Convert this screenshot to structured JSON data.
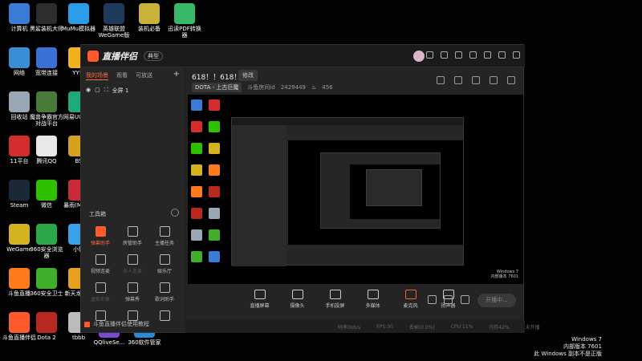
{
  "desktop_icons_col1": [
    {
      "label": "计算机",
      "color": "#3a7bd5"
    },
    {
      "label": "网络",
      "color": "#3a8ed5"
    },
    {
      "label": "回收站",
      "color": "#9aa7b5"
    },
    {
      "label": "11平台",
      "color": "#d42d2d"
    },
    {
      "label": "Steam",
      "color": "#1b2838"
    },
    {
      "label": "WeGame",
      "color": "#d4b21f"
    },
    {
      "label": "斗鱼直播",
      "color": "#ff7a1a"
    },
    {
      "label": "斗鱼直播伴侣",
      "color": "#ff5a2c"
    }
  ],
  "desktop_icons_col2": [
    {
      "label": "黑鲨装机大师",
      "color": "#2d2d2d"
    },
    {
      "label": "宽带连接",
      "color": "#3a6fd5"
    },
    {
      "label": "魔兽争霸官方对战平台",
      "color": "#4a7a3a"
    },
    {
      "label": "腾讯QQ",
      "color": "#e8e8e8"
    },
    {
      "label": "微信",
      "color": "#2dc100"
    },
    {
      "label": "360安全浏览器",
      "color": "#2aa84a"
    },
    {
      "label": "360安全卫士",
      "color": "#3fae2a"
    },
    {
      "label": "Dota 2",
      "color": "#b8281e"
    }
  ],
  "desktop_icons_col3": [
    {
      "label": "MuMu模拟器",
      "color": "#2b9de8"
    },
    {
      "label": "YY语",
      "color": "#f2b01e"
    },
    {
      "label": "网易UU加速",
      "color": "#1fa87a"
    },
    {
      "label": "BS",
      "color": "#d4a21f"
    },
    {
      "label": "暴雨(Mahjo",
      "color": "#c82a3a"
    },
    {
      "label": "小智",
      "color": "#3aa0e8"
    },
    {
      "label": "新天龙之小",
      "color": "#e8a01f"
    },
    {
      "label": "tbbb",
      "color": "#bbbbbb"
    }
  ],
  "desktop_icons_top": [
    {
      "label": "英雄联盟WeGame版",
      "color": "#1e3a5a"
    },
    {
      "label": "装机必备",
      "color": "#c8b23a"
    },
    {
      "label": "迅读PDF转换器",
      "color": "#3ab86a"
    }
  ],
  "desktop_icons_bottom": [
    {
      "label": "QQliveSe...",
      "color": "#7a4ad5"
    },
    {
      "label": "360软件管家",
      "color": "#2a8ad5"
    }
  ],
  "app": {
    "title": "直播伴侣",
    "version_badge": "典型",
    "left_tabs": [
      "我的场景",
      "观看",
      "可放送"
    ],
    "add_label": "+",
    "scene_item": "全屏 1",
    "toolbox_title": "工具箱",
    "tools": [
      {
        "label": "弹幕助手",
        "state": "hot"
      },
      {
        "label": "房管助手",
        "state": "normal"
      },
      {
        "label": "主播任务",
        "state": "normal"
      },
      {
        "label": "视频连麦",
        "state": "normal"
      },
      {
        "label": "多人连麦",
        "state": "dim"
      },
      {
        "label": "娱乐厅",
        "state": "normal"
      },
      {
        "label": "虚拟形象",
        "state": "dim"
      },
      {
        "label": "弹幕秀",
        "state": "normal"
      },
      {
        "label": "歌词助手",
        "state": "normal"
      },
      {
        "label": "",
        "state": "normal"
      },
      {
        "label": "",
        "state": "normal"
      },
      {
        "label": "",
        "state": "normal"
      }
    ],
    "tutorial_label": "斗鱼直播伴侣使用教程",
    "stream_title": "618！！618！！",
    "edit_label": "修改",
    "category": "DOTA - 上古巨魔",
    "room_id_label": "斗鱼房间id",
    "room_id": "2429449",
    "hot_value": "456",
    "controls": [
      {
        "label": "直播屏幕",
        "accent": false
      },
      {
        "label": "摄像头",
        "accent": false
      },
      {
        "label": "手机投屏",
        "accent": false
      },
      {
        "label": "多媒体",
        "accent": false
      },
      {
        "label": "麦克风",
        "accent": true
      },
      {
        "label": "扬声器",
        "accent": false
      }
    ],
    "go_live_label": "开播中...",
    "status": [
      "码率0kb/s",
      "FPS:30",
      "丢帧(0.0%)",
      "CPU:11%",
      "内存42%",
      "未开播"
    ]
  },
  "watermark": {
    "line1": "Windows 7",
    "line2": "内部版本 7601",
    "line3": "此 Windows 副本不是正版"
  },
  "colors": {
    "accent": "#ff5a2c",
    "panel": "#242424",
    "desktop": "#030303"
  }
}
